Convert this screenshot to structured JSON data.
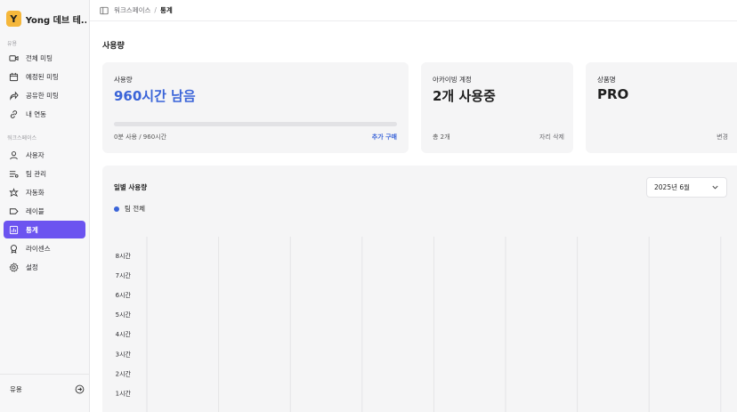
{
  "workspace": {
    "logo_letter": "Y",
    "name": "Yong 데브 테..."
  },
  "sidebar": {
    "section_usage": "유용",
    "usage_items": [
      {
        "label": "전체 미팅",
        "icon": "video-icon"
      },
      {
        "label": "예정된 미팅",
        "icon": "calendar-icon"
      },
      {
        "label": "공유한 미팅",
        "icon": "share-icon"
      },
      {
        "label": "내 연동",
        "icon": "link-icon"
      }
    ],
    "section_workspace": "워크스페이스",
    "workspace_items": [
      {
        "label": "사용자",
        "icon": "user-icon"
      },
      {
        "label": "팀 관리",
        "icon": "team-list-icon"
      },
      {
        "label": "자동화",
        "icon": "automation-icon"
      },
      {
        "label": "레이블",
        "icon": "tag-icon"
      },
      {
        "label": "통계",
        "icon": "stats-icon",
        "active": true
      },
      {
        "label": "라이센스",
        "icon": "license-icon"
      },
      {
        "label": "설정",
        "icon": "gear-icon"
      }
    ],
    "footer_label": "유용"
  },
  "breadcrumb": {
    "parent": "워크스페이스",
    "separator": "/",
    "current": "통계"
  },
  "page_title": "사용량",
  "cards": {
    "usage": {
      "label": "사용량",
      "value": "960시간 남음",
      "progress_fraction": 0.0,
      "used_text": "0분 사용 / 960시간",
      "action": "추가 구매"
    },
    "archiving": {
      "label": "아카이빙 계정",
      "value": "2개 사용중",
      "total": "총 2개",
      "action": "자리 삭제"
    },
    "plan": {
      "label": "상품명",
      "value": "PRO",
      "action": "변경"
    }
  },
  "monthly": {
    "title": "일별 사용량",
    "month": "2025년 6월",
    "legend": "팀 전체"
  },
  "colors": {
    "accent": "#6c54f0",
    "series": "#3a64d8",
    "brand_logo": "#f5b73b"
  },
  "chart_data": {
    "type": "bar",
    "series": [
      {
        "name": "팀 전체",
        "values": []
      }
    ],
    "y_ticks": [
      "1시간",
      "2시간",
      "3시간",
      "4시간",
      "5시간",
      "6시간",
      "7시간",
      "8시간"
    ],
    "ylim": [
      0,
      8
    ],
    "grid": "vertical"
  }
}
